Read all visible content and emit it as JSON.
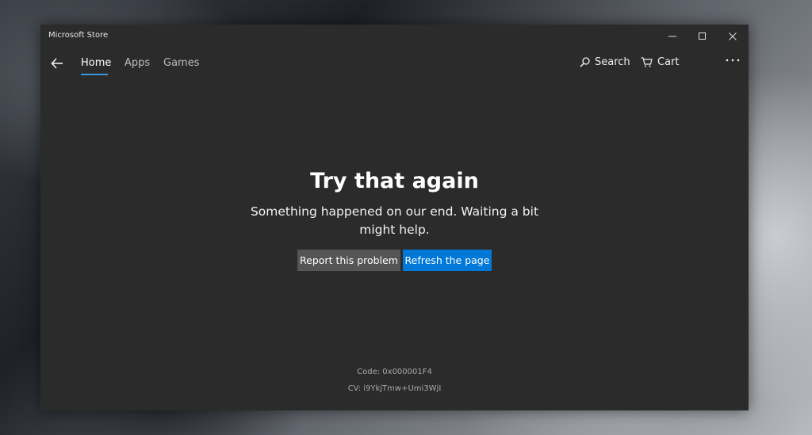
{
  "window": {
    "title": "Microsoft Store"
  },
  "nav": {
    "tabs": [
      {
        "label": "Home",
        "active": true
      },
      {
        "label": "Apps",
        "active": false
      },
      {
        "label": "Games",
        "active": false
      }
    ],
    "search_label": "Search",
    "cart_label": "Cart"
  },
  "error": {
    "title": "Try that again",
    "message": "Something happened on our end. Waiting a bit might help.",
    "report_button": "Report this problem",
    "refresh_button": "Refresh the page",
    "code": "Code: 0x000001F4",
    "cv": "CV: i9YkjTmw+Umi3WjI"
  },
  "colors": {
    "accent": "#0078d7",
    "tab_underline": "#3a96dd",
    "secondary_button": "#555555",
    "background": "#2b2b2b"
  },
  "icons": [
    "back-arrow-icon",
    "search-icon",
    "cart-icon",
    "more-icon",
    "minimize-icon",
    "maximize-icon",
    "close-icon"
  ]
}
